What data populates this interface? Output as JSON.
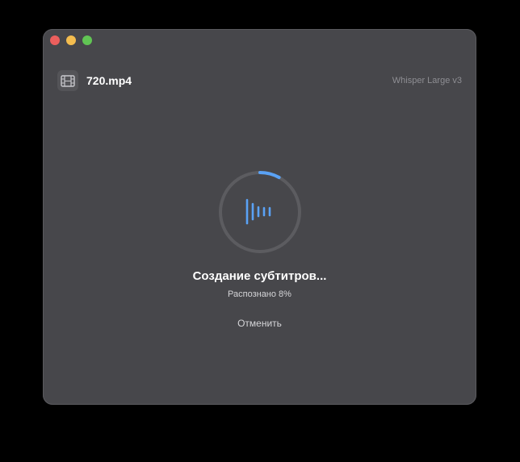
{
  "window": {
    "file_name": "720.mp4",
    "model": "Whisper Large v3"
  },
  "progress": {
    "title": "Создание субтитров...",
    "status": "Распознано 8%",
    "percent": 8,
    "accent_color": "#5aa2f5"
  },
  "actions": {
    "cancel_label": "Отменить"
  },
  "icons": {
    "file": "film-icon",
    "center": "waveform-icon"
  }
}
